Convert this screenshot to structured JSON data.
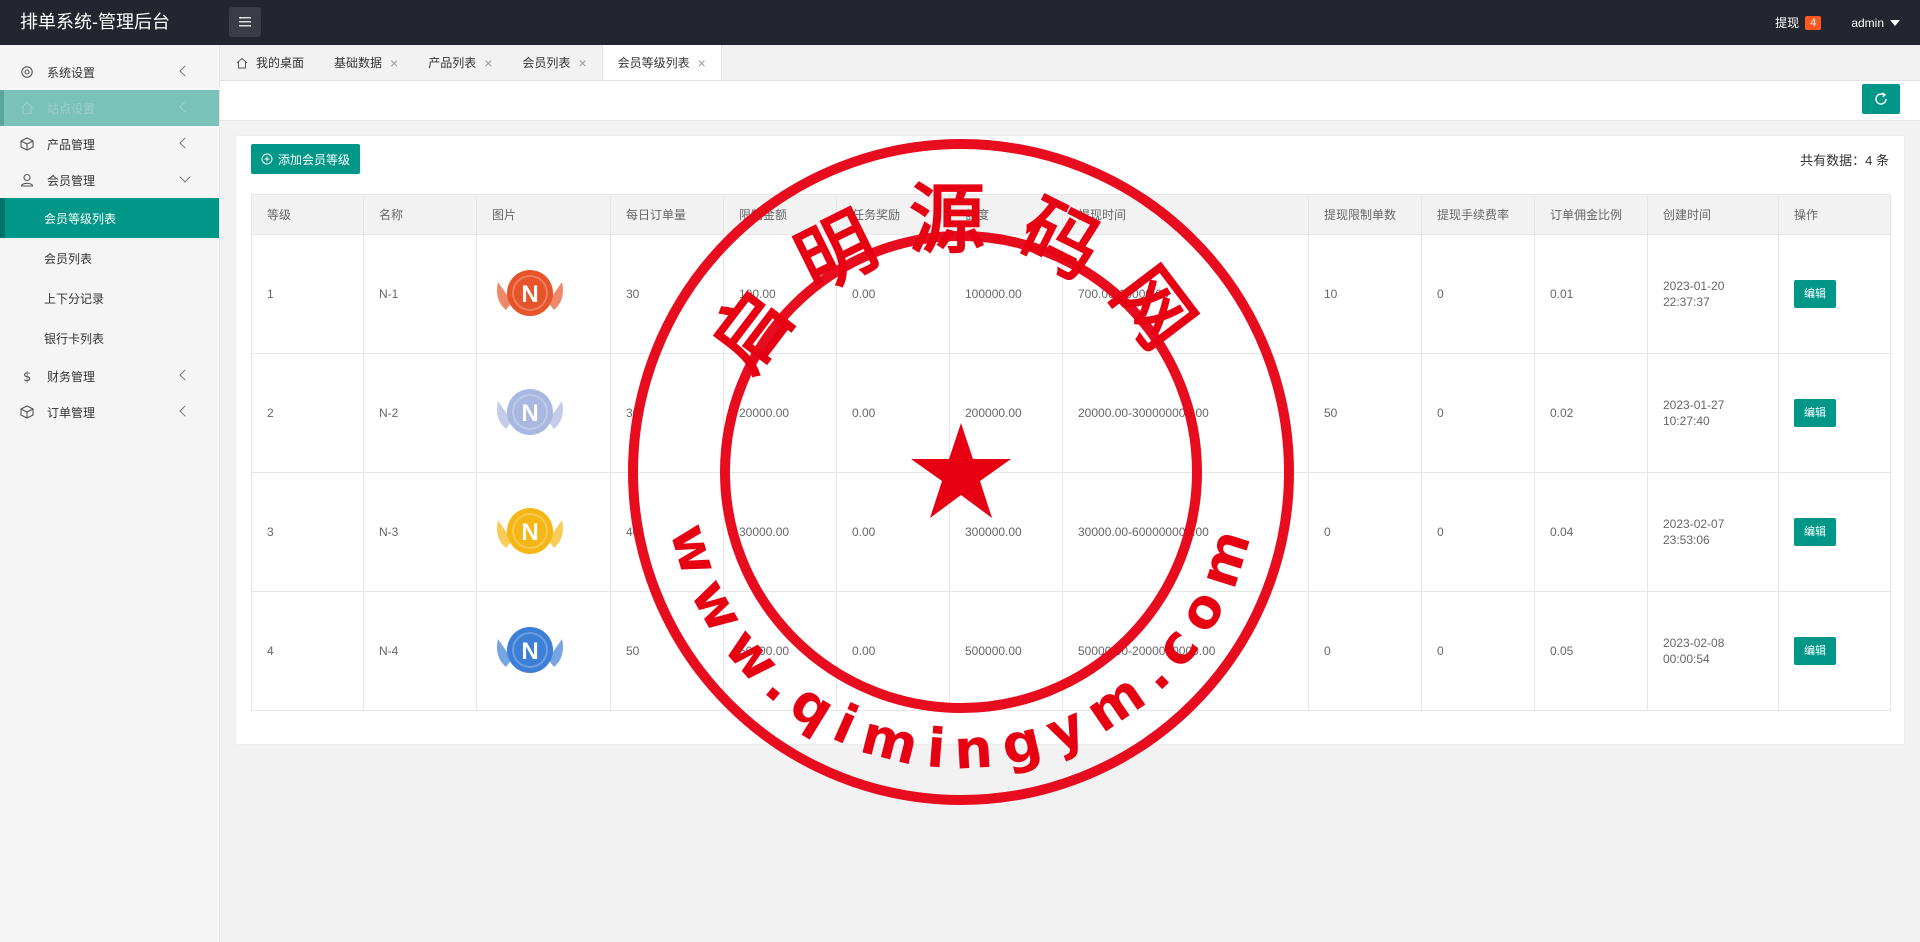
{
  "header": {
    "title": "排单系统-管理后台",
    "withdraw_label": "提现",
    "withdraw_count": "4",
    "user": "admin"
  },
  "sidebar": {
    "items": [
      {
        "label": "系统设置"
      },
      {
        "label": "站点设置"
      },
      {
        "label": "产品管理"
      },
      {
        "label": "会员管理"
      }
    ],
    "sub_items": [
      {
        "label": "会员等级列表"
      },
      {
        "label": "会员列表"
      },
      {
        "label": "上下分记录"
      },
      {
        "label": "银行卡列表"
      }
    ],
    "bottom_items": [
      {
        "label": "财务管理"
      },
      {
        "label": "订单管理"
      }
    ]
  },
  "tabs": [
    {
      "label": "我的桌面"
    },
    {
      "label": "基础数据"
    },
    {
      "label": "产品列表"
    },
    {
      "label": "会员列表"
    },
    {
      "label": "会员等级列表"
    }
  ],
  "card": {
    "add_button": "添加会员等级",
    "total": "共有数据：4 条"
  },
  "table": {
    "headers": [
      "等级",
      "名称",
      "图片",
      "每日订单量",
      "限制金额",
      "任务奖励",
      "额度",
      "提现时间",
      "提现限制单数",
      "提现手续费率",
      "订单佣金比例",
      "创建时间",
      "操作"
    ],
    "rows": [
      {
        "level": "1",
        "name": "N-1",
        "daily": "30",
        "limit": "100.00",
        "reward": "0.00",
        "quota": "100000.00",
        "range": "700.00-10000.00",
        "min_orders": "10",
        "fee": "0",
        "commission": "0.01",
        "created": "2023-01-20 22:37:37",
        "action": "编辑",
        "badge_color": "#e8542a"
      },
      {
        "level": "2",
        "name": "N-2",
        "daily": "30",
        "limit": "20000.00",
        "reward": "0.00",
        "quota": "200000.00",
        "range": "20000.00-300000000.00",
        "min_orders": "50",
        "fee": "0",
        "commission": "0.02",
        "created": "2023-01-27 10:27:40",
        "action": "编辑",
        "badge_color": "#a9b8e0"
      },
      {
        "level": "3",
        "name": "N-3",
        "daily": "40",
        "limit": "30000.00",
        "reward": "0.00",
        "quota": "300000.00",
        "range": "30000.00-600000000.00",
        "min_orders": "0",
        "fee": "0",
        "commission": "0.04",
        "created": "2023-02-07 23:53:06",
        "action": "编辑",
        "badge_color": "#f6b716"
      },
      {
        "level": "4",
        "name": "N-4",
        "daily": "50",
        "limit": "50000.00",
        "reward": "0.00",
        "quota": "500000.00",
        "range": "50000.00-2000000000.00",
        "min_orders": "0",
        "fee": "0",
        "commission": "0.05",
        "created": "2023-02-08 00:00:54",
        "action": "编辑",
        "badge_color": "#3d7fd6"
      }
    ]
  },
  "watermark": {
    "top_text": "启明源码网",
    "bottom_text": "www.qimingym.com",
    "color": "#e60012"
  }
}
